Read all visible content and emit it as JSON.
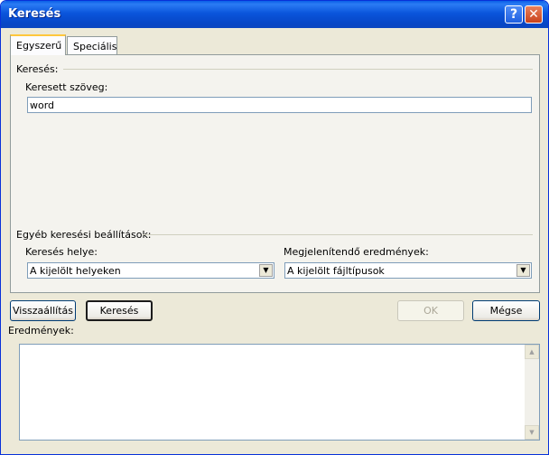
{
  "window": {
    "title": "Keresés"
  },
  "titlebar_buttons": {
    "help": "?",
    "close": "✕"
  },
  "tabs": [
    {
      "label": "Egyszerű",
      "active": true
    },
    {
      "label": "Speciális",
      "active": false
    }
  ],
  "search_group": {
    "label": "Keresés:",
    "text_label": "Keresett szöveg:",
    "text_value": "word"
  },
  "other_group": {
    "label": "Egyéb keresési beállítások:",
    "location_label": "Keresés helye:",
    "location_value": "A kijelölt helyeken",
    "results_type_label": "Megjelenítendő eredmények:",
    "results_type_value": "A kijelölt fájltípusok"
  },
  "buttons": {
    "reset": "Visszaállítás",
    "search": "Keresés",
    "ok": "OK",
    "cancel": "Mégse"
  },
  "results": {
    "label": "Eredmények:"
  },
  "icons": {
    "dropdown_arrow": "▼",
    "scroll_up": "▲",
    "scroll_down": "▼"
  },
  "colors": {
    "title_bar": "#0a55dc",
    "dialog_bg": "#ece9d8",
    "panel_bg": "#f4f3ee",
    "close_button": "#c9421b"
  }
}
